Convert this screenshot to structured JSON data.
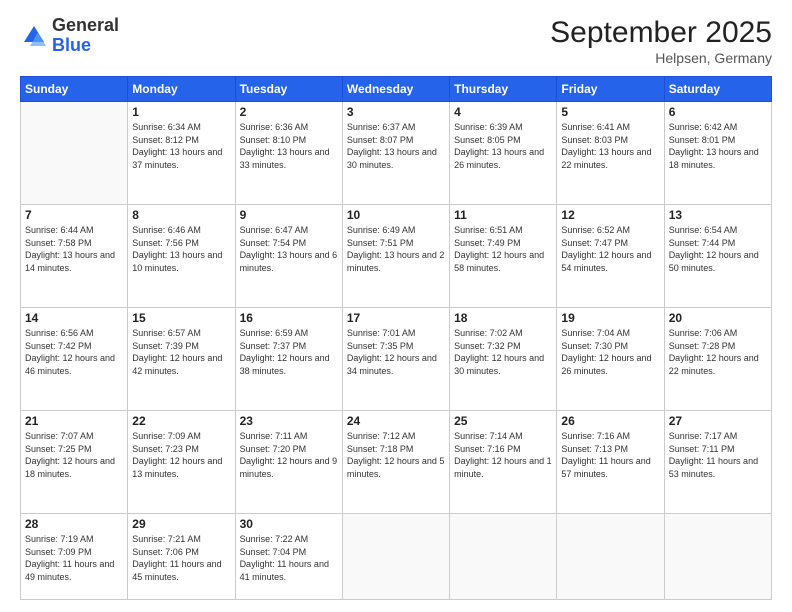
{
  "logo": {
    "general": "General",
    "blue": "Blue"
  },
  "title": "September 2025",
  "subtitle": "Helpsen, Germany",
  "weekdays": [
    "Sunday",
    "Monday",
    "Tuesday",
    "Wednesday",
    "Thursday",
    "Friday",
    "Saturday"
  ],
  "weeks": [
    [
      {
        "day": "",
        "sunrise": "",
        "sunset": "",
        "daylight": ""
      },
      {
        "day": "1",
        "sunrise": "Sunrise: 6:34 AM",
        "sunset": "Sunset: 8:12 PM",
        "daylight": "Daylight: 13 hours and 37 minutes."
      },
      {
        "day": "2",
        "sunrise": "Sunrise: 6:36 AM",
        "sunset": "Sunset: 8:10 PM",
        "daylight": "Daylight: 13 hours and 33 minutes."
      },
      {
        "day": "3",
        "sunrise": "Sunrise: 6:37 AM",
        "sunset": "Sunset: 8:07 PM",
        "daylight": "Daylight: 13 hours and 30 minutes."
      },
      {
        "day": "4",
        "sunrise": "Sunrise: 6:39 AM",
        "sunset": "Sunset: 8:05 PM",
        "daylight": "Daylight: 13 hours and 26 minutes."
      },
      {
        "day": "5",
        "sunrise": "Sunrise: 6:41 AM",
        "sunset": "Sunset: 8:03 PM",
        "daylight": "Daylight: 13 hours and 22 minutes."
      },
      {
        "day": "6",
        "sunrise": "Sunrise: 6:42 AM",
        "sunset": "Sunset: 8:01 PM",
        "daylight": "Daylight: 13 hours and 18 minutes."
      }
    ],
    [
      {
        "day": "7",
        "sunrise": "Sunrise: 6:44 AM",
        "sunset": "Sunset: 7:58 PM",
        "daylight": "Daylight: 13 hours and 14 minutes."
      },
      {
        "day": "8",
        "sunrise": "Sunrise: 6:46 AM",
        "sunset": "Sunset: 7:56 PM",
        "daylight": "Daylight: 13 hours and 10 minutes."
      },
      {
        "day": "9",
        "sunrise": "Sunrise: 6:47 AM",
        "sunset": "Sunset: 7:54 PM",
        "daylight": "Daylight: 13 hours and 6 minutes."
      },
      {
        "day": "10",
        "sunrise": "Sunrise: 6:49 AM",
        "sunset": "Sunset: 7:51 PM",
        "daylight": "Daylight: 13 hours and 2 minutes."
      },
      {
        "day": "11",
        "sunrise": "Sunrise: 6:51 AM",
        "sunset": "Sunset: 7:49 PM",
        "daylight": "Daylight: 12 hours and 58 minutes."
      },
      {
        "day": "12",
        "sunrise": "Sunrise: 6:52 AM",
        "sunset": "Sunset: 7:47 PM",
        "daylight": "Daylight: 12 hours and 54 minutes."
      },
      {
        "day": "13",
        "sunrise": "Sunrise: 6:54 AM",
        "sunset": "Sunset: 7:44 PM",
        "daylight": "Daylight: 12 hours and 50 minutes."
      }
    ],
    [
      {
        "day": "14",
        "sunrise": "Sunrise: 6:56 AM",
        "sunset": "Sunset: 7:42 PM",
        "daylight": "Daylight: 12 hours and 46 minutes."
      },
      {
        "day": "15",
        "sunrise": "Sunrise: 6:57 AM",
        "sunset": "Sunset: 7:39 PM",
        "daylight": "Daylight: 12 hours and 42 minutes."
      },
      {
        "day": "16",
        "sunrise": "Sunrise: 6:59 AM",
        "sunset": "Sunset: 7:37 PM",
        "daylight": "Daylight: 12 hours and 38 minutes."
      },
      {
        "day": "17",
        "sunrise": "Sunrise: 7:01 AM",
        "sunset": "Sunset: 7:35 PM",
        "daylight": "Daylight: 12 hours and 34 minutes."
      },
      {
        "day": "18",
        "sunrise": "Sunrise: 7:02 AM",
        "sunset": "Sunset: 7:32 PM",
        "daylight": "Daylight: 12 hours and 30 minutes."
      },
      {
        "day": "19",
        "sunrise": "Sunrise: 7:04 AM",
        "sunset": "Sunset: 7:30 PM",
        "daylight": "Daylight: 12 hours and 26 minutes."
      },
      {
        "day": "20",
        "sunrise": "Sunrise: 7:06 AM",
        "sunset": "Sunset: 7:28 PM",
        "daylight": "Daylight: 12 hours and 22 minutes."
      }
    ],
    [
      {
        "day": "21",
        "sunrise": "Sunrise: 7:07 AM",
        "sunset": "Sunset: 7:25 PM",
        "daylight": "Daylight: 12 hours and 18 minutes."
      },
      {
        "day": "22",
        "sunrise": "Sunrise: 7:09 AM",
        "sunset": "Sunset: 7:23 PM",
        "daylight": "Daylight: 12 hours and 13 minutes."
      },
      {
        "day": "23",
        "sunrise": "Sunrise: 7:11 AM",
        "sunset": "Sunset: 7:20 PM",
        "daylight": "Daylight: 12 hours and 9 minutes."
      },
      {
        "day": "24",
        "sunrise": "Sunrise: 7:12 AM",
        "sunset": "Sunset: 7:18 PM",
        "daylight": "Daylight: 12 hours and 5 minutes."
      },
      {
        "day": "25",
        "sunrise": "Sunrise: 7:14 AM",
        "sunset": "Sunset: 7:16 PM",
        "daylight": "Daylight: 12 hours and 1 minute."
      },
      {
        "day": "26",
        "sunrise": "Sunrise: 7:16 AM",
        "sunset": "Sunset: 7:13 PM",
        "daylight": "Daylight: 11 hours and 57 minutes."
      },
      {
        "day": "27",
        "sunrise": "Sunrise: 7:17 AM",
        "sunset": "Sunset: 7:11 PM",
        "daylight": "Daylight: 11 hours and 53 minutes."
      }
    ],
    [
      {
        "day": "28",
        "sunrise": "Sunrise: 7:19 AM",
        "sunset": "Sunset: 7:09 PM",
        "daylight": "Daylight: 11 hours and 49 minutes."
      },
      {
        "day": "29",
        "sunrise": "Sunrise: 7:21 AM",
        "sunset": "Sunset: 7:06 PM",
        "daylight": "Daylight: 11 hours and 45 minutes."
      },
      {
        "day": "30",
        "sunrise": "Sunrise: 7:22 AM",
        "sunset": "Sunset: 7:04 PM",
        "daylight": "Daylight: 11 hours and 41 minutes."
      },
      {
        "day": "",
        "sunrise": "",
        "sunset": "",
        "daylight": ""
      },
      {
        "day": "",
        "sunrise": "",
        "sunset": "",
        "daylight": ""
      },
      {
        "day": "",
        "sunrise": "",
        "sunset": "",
        "daylight": ""
      },
      {
        "day": "",
        "sunrise": "",
        "sunset": "",
        "daylight": ""
      }
    ]
  ]
}
